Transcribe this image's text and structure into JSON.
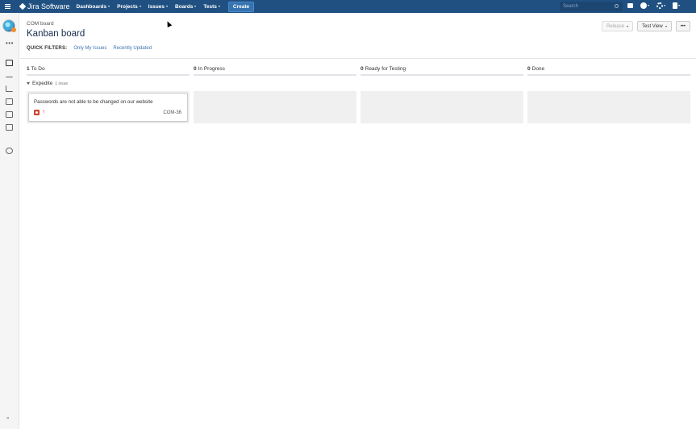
{
  "topnav": {
    "brand": "Jira Software",
    "menu": [
      "Dashboards",
      "Projects",
      "Issues",
      "Boards",
      "Tests"
    ],
    "create_label": "Create",
    "search_placeholder": "Search"
  },
  "page": {
    "breadcrumb": "COM board",
    "title": "Kanban board",
    "releases_label": "Release",
    "view_label": "Test View",
    "more_label": "•••"
  },
  "quick_filters": {
    "label": "QUICK FILTERS:",
    "items": [
      "Only My Issues",
      "Recently Updated"
    ]
  },
  "columns": [
    {
      "count": "1",
      "name": "To Do"
    },
    {
      "count": "0",
      "name": "In Progress"
    },
    {
      "count": "0",
      "name": "Ready for Testing"
    },
    {
      "count": "0",
      "name": "Done"
    }
  ],
  "swimlane": {
    "name": "Expedite",
    "count": "1 issue"
  },
  "card": {
    "summary": "Passwords are not able to be changed on our website",
    "priority_glyph": "↑",
    "key": "COM-36"
  },
  "sidebar": {
    "more": "•••",
    "collapse": "»"
  }
}
